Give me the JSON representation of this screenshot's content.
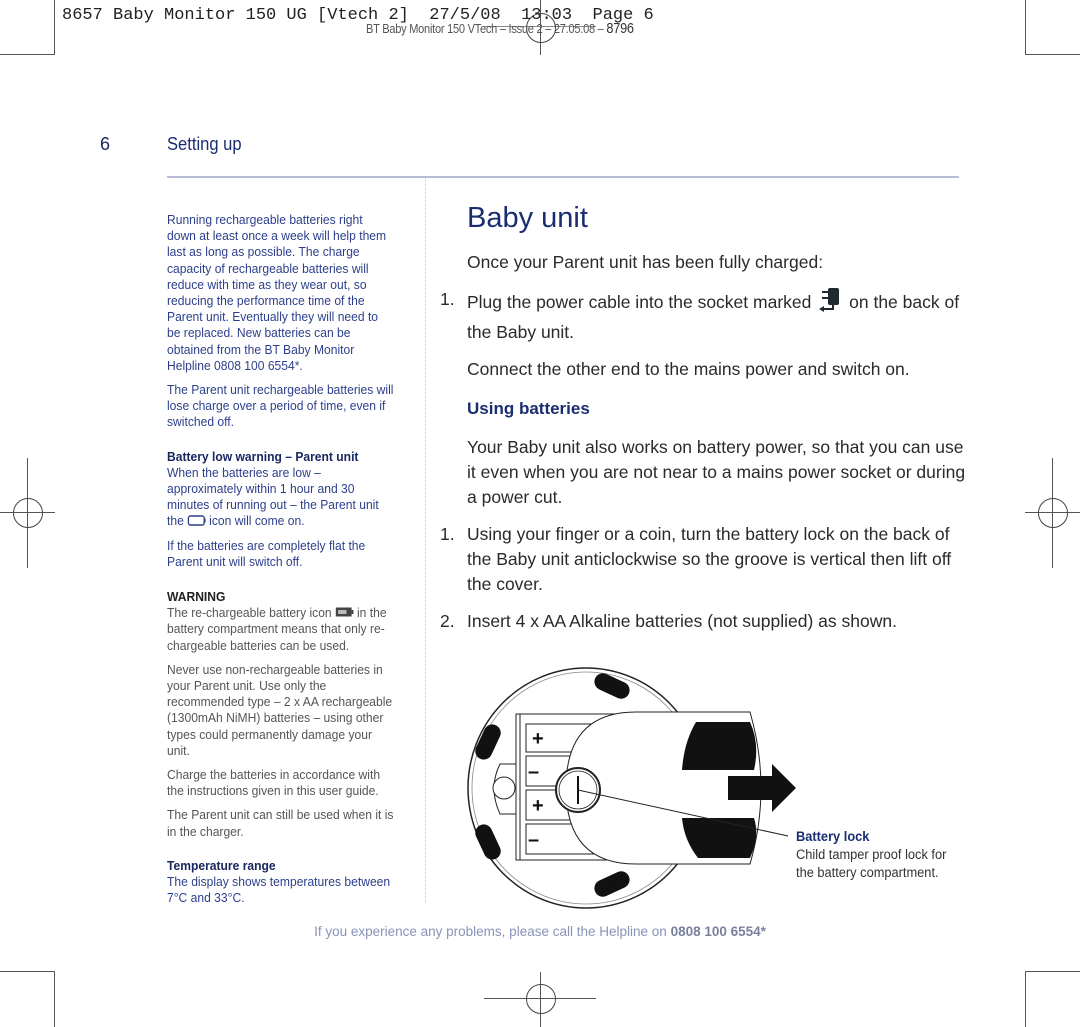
{
  "print_slug": {
    "job_line": "8657 Baby Monitor 150 UG [Vtech 2]  27/5/08  13:03  Page 6",
    "doc_line": "BT Baby Monitor 150 VTech – Issue 2 – 27.05.08 –",
    "doc_code": "8796"
  },
  "header": {
    "page_number": "6",
    "section_title": "Setting up"
  },
  "sidebar": {
    "p1": "Running rechargeable batteries right down at least once a week will help them last as long as possible. The charge capacity of rechargeable batteries will reduce with time as they wear out, so reducing the performance time of the Parent unit. Eventually they will need to be replaced. New batteries can be obtained from the BT Baby Monitor Helpline 0808 100 6554*.",
    "p2": "The Parent unit rechargeable batteries will lose charge over a period of time, even if switched off.",
    "battery_low_heading": "Battery low warning – Parent unit",
    "battery_low_text_before_icon": "When the batteries are low – approximately within 1 hour and 30 minutes of running out – the Parent unit the",
    "battery_low_icon": "battery-empty-icon",
    "battery_low_text_after_icon": "icon will come on.",
    "p_flat": "If the batteries are completely flat the Parent unit will switch off.",
    "warning_heading": "WARNING",
    "warning_text_before_icon": "The re-chargeable battery icon",
    "warning_icon": "rechargeable-battery-icon",
    "warning_text_after_icon": "in the battery compartment means that only re-chargeable batteries can be used.",
    "p_never": "Never use non-rechargeable batteries in your Parent unit. Use only the recommended type – 2 x AA rechargeable (1300mAh NiMH) batteries – using other types could permanently damage your unit.",
    "p_charge": "Charge the batteries in accordance with the instructions given in this user guide.",
    "p_charger": "The Parent unit can still be used when it is in the charger.",
    "temperature_heading": "Temperature range",
    "temperature_text": "The display shows temperatures between 7°C and 33°C."
  },
  "main": {
    "title": "Baby unit",
    "intro": "Once your Parent unit has been fully charged:",
    "steps_power": [
      {
        "number": "1.",
        "text_before_icon": "Plug the power cable into the socket marked",
        "icon": "power-adapter-icon",
        "text_after_icon": "on the back of the Baby unit."
      }
    ],
    "connect_text": "Connect the other end to the mains power and switch on.",
    "batteries_heading": "Using batteries",
    "batteries_intro": "Your Baby unit also works on battery power, so that you can use it even when you are not near to a mains power socket or during a power cut.",
    "steps_batteries": [
      {
        "number": "1.",
        "text": "Using your finger or a coin, turn the battery lock on the back of the Baby unit anticlockwise so the groove is vertical then lift off the cover."
      },
      {
        "number": "2.",
        "text": "Insert 4 x AA Alkaline batteries (not supplied) as shown."
      }
    ],
    "diagram": {
      "polarity_labels": [
        "+",
        "–",
        "+",
        "–"
      ],
      "callout_heading": "Battery lock",
      "callout_text": "Child tamper proof lock for the battery compartment."
    }
  },
  "footer": {
    "text": "If you experience any problems, please call the Helpline on",
    "phone": "0808 100 6554*"
  }
}
